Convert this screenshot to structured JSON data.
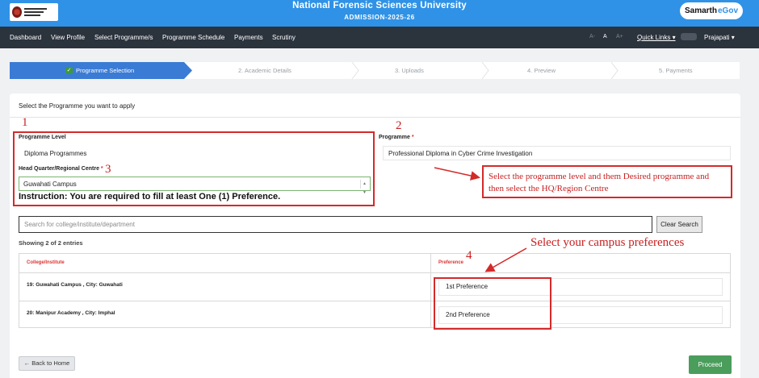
{
  "header": {
    "title": "National Forensic Sciences University",
    "subtitle": "ADMISSION-2025-26",
    "brand_main": "Samarth",
    "brand_accent": "eGov"
  },
  "nav": {
    "items": [
      "Dashboard",
      "View Profile",
      "Select Programme/s",
      "Programme Schedule",
      "Payments",
      "Scrutiny"
    ],
    "font_sizes": [
      "A-",
      "A",
      "A+"
    ],
    "quick_links": "Quick Links ▾",
    "user": "Prajapati ▾"
  },
  "wizard": {
    "steps": [
      "Programme Selection",
      "2. Academic Details",
      "3. Uploads",
      "4. Preview",
      "5. Payments"
    ],
    "active_index": 0
  },
  "form": {
    "heading": "Select the Programme you want to apply",
    "programme_level_label": "Programme Level",
    "programme_level_value": "Diploma Programmes",
    "programme_label": "Programme",
    "programme_value": "Professional Diploma in Cyber Crime Investigation",
    "hq_label": "Head Quarter/Regional Centre",
    "hq_value": "Guwahati Campus",
    "instruction": "Instruction: You are required to fill at least One (1) Preference.",
    "search_placeholder": "Search for college/institute/department",
    "clear_search": "Clear Search",
    "showing": "Showing 2 of 2 entries"
  },
  "table": {
    "headers": [
      "College/Institute",
      "Preference"
    ],
    "rows": [
      {
        "college": "19: Guwahati Campus , City: Guwahati",
        "preference": "1st Preference"
      },
      {
        "college": "20: Manipur Academy , City: Imphal",
        "preference": "2nd Preference"
      }
    ]
  },
  "buttons": {
    "back": "← Back to Home",
    "proceed": "Proceed"
  },
  "annotations": {
    "numbers": [
      "1",
      "2",
      "3",
      "4"
    ],
    "note_programme": "Select the programme level and them Desired programme and then select the HQ/Region Centre",
    "note_campus": "Select your campus preferences",
    "color": "#d42a2a"
  },
  "colors": {
    "topbar": "#2f92e6",
    "navbar": "#2b333d",
    "wizard_active": "#3a7bd5",
    "proceed": "#4a9d5b",
    "required": "#dd3333"
  }
}
